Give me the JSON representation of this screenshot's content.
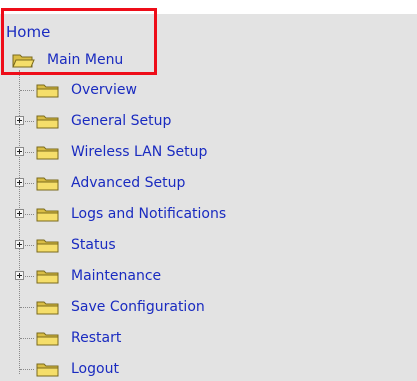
{
  "nav": {
    "home_label": "Home",
    "main_menu_label": "Main Menu",
    "items": [
      {
        "label": "Overview",
        "expandable": false
      },
      {
        "label": "General Setup",
        "expandable": true
      },
      {
        "label": "Wireless LAN Setup",
        "expandable": true
      },
      {
        "label": "Advanced Setup",
        "expandable": true
      },
      {
        "label": "Logs and Notifications",
        "expandable": true
      },
      {
        "label": "Status",
        "expandable": true
      },
      {
        "label": "Maintenance",
        "expandable": true
      },
      {
        "label": "Save Configuration",
        "expandable": false
      },
      {
        "label": "Restart",
        "expandable": false
      },
      {
        "label": "Logout",
        "expandable": false
      }
    ]
  },
  "icons": {
    "folder": "folder-icon",
    "folder_open": "open-folder-icon",
    "expander": "plus-box-icon"
  },
  "colors": {
    "link": "#1a2bc0",
    "panel_background": "#e3e3e3",
    "highlight_border": "#ee0d19",
    "folder_fill": "#f5de6a",
    "folder_outline": "#7a6a1c"
  }
}
